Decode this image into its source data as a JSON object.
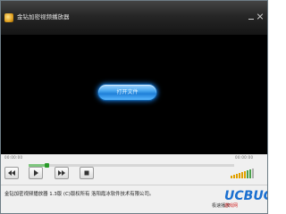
{
  "window": {
    "title": "金钻加密视频播放器",
    "minimize_label": "—",
    "close_label": "×"
  },
  "video": {
    "open_file_label": "打开文件"
  },
  "timeline": {
    "elapsed": "00:00:00",
    "total": "00:00:00"
  },
  "controls": {
    "progress_fraction": 0.08,
    "volume_level": 0.7
  },
  "status": {
    "text": "金钻加密视频播放器 1.3版 (C)版权所有 洛阳霞冰软件技术有限公司。",
    "extra_label": "极速播放"
  },
  "watermark": {
    "brand": "UCBUG",
    "sub": "游戏网"
  },
  "colors": {
    "titlebar": "#262626",
    "video_bg": "#000000",
    "open_button": "#1e7fd8",
    "progress_fill": "#7fc67f"
  },
  "icons": {
    "prev": "rewind-icon",
    "play": "play-icon",
    "next": "fast-forward-icon",
    "stop": "stop-icon",
    "volume": "volume-bars-icon"
  }
}
